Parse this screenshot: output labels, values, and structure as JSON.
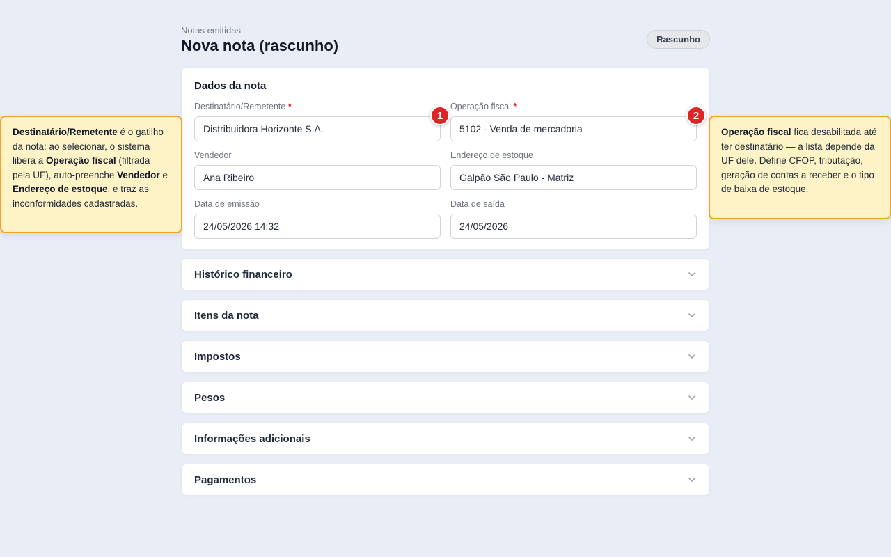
{
  "header": {
    "breadcrumb": "Notas emitidas",
    "title": "Nova nota (rascunho)",
    "status_badge": "Rascunho"
  },
  "main_card": {
    "title": "Dados da nota",
    "fields": [
      {
        "label": "Destinatário/Remetente",
        "required": "*",
        "value": "Distribuidora Horizonte S.A."
      },
      {
        "label": "Operação fiscal",
        "required": "*",
        "value": "5102 - Venda de mercadoria"
      },
      {
        "label": "Vendedor",
        "value": "Ana Ribeiro"
      },
      {
        "label": "Endereço de estoque",
        "value": "Galpão São Paulo - Matriz"
      },
      {
        "label": "Data de emissão",
        "value": "24/05/2026 14:32"
      },
      {
        "label": "Data de saída",
        "value": "24/05/2026"
      }
    ]
  },
  "sections": [
    {
      "title": "Histórico financeiro"
    },
    {
      "title": "Itens da nota"
    },
    {
      "title": "Impostos"
    },
    {
      "title": "Pesos"
    },
    {
      "title": "Informações adicionais"
    },
    {
      "title": "Pagamentos"
    }
  ],
  "markers": [
    "1",
    "2"
  ],
  "callouts": {
    "left": {
      "b1": "Destinatário/Remetente",
      "t1": " é o gatilho da nota: ao selecionar, o sistema libera a ",
      "b2": "Operação fiscal",
      "t2": " (filtrada pela UF), auto-preenche ",
      "b3": "Vendedor",
      "t3": " e ",
      "b4": "Endereço de estoque",
      "t4": ", e traz as inconformidades cadastradas."
    },
    "right": {
      "b1": "Operação fiscal",
      "t1": " fica desabilitada até ter destinatário — a lista depende da UF dele. Define CFOP, tributação, geração de contas a receber e o tipo de baixa de estoque."
    }
  },
  "colors": {
    "background": "#e9edf5",
    "marker": "#dc2626",
    "callout_bg": "#fef3c7",
    "callout_border": "#f0a32a",
    "required": "#dc2626"
  },
  "icons": {
    "accordion": "chevron-down-icon"
  }
}
